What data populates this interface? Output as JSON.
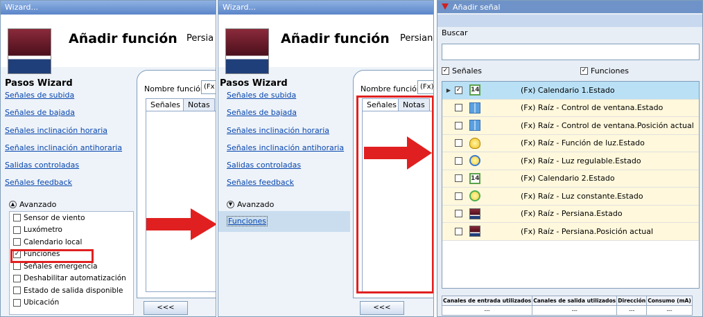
{
  "wizard_title": "Wizard...",
  "header": {
    "title": "Añadir función",
    "subtitle_p1": "Persia",
    "subtitle_p2": "Persian"
  },
  "steps_title": "Pasos Wizard",
  "steps": [
    "Señales de subida",
    "Señales de bajada",
    "Señales inclinación horaria",
    "Señales inclinación antihoraria",
    "Salidas controladas",
    "Señales feedback"
  ],
  "advanced_label": "Avanzado",
  "advanced_options": [
    {
      "label": "Sensor de viento",
      "checked": false
    },
    {
      "label": "Luxómetro",
      "checked": false
    },
    {
      "label": "Calendario local",
      "checked": false
    },
    {
      "label": "Funciones",
      "checked": true
    },
    {
      "label": "Señales emergencia",
      "checked": false
    },
    {
      "label": "Deshabilitar automatización",
      "checked": false
    },
    {
      "label": "Estado de salida disponible",
      "checked": false
    },
    {
      "label": "Ubicación",
      "checked": false
    }
  ],
  "funciones_link": "Funciones",
  "function_name_label": "Nombre función:",
  "function_name_value_p1": "(Fx",
  "function_name_value_p2": "(Fx)",
  "tabs": [
    "Señales",
    "Notas"
  ],
  "back_button": "<<<",
  "signal_dialog": {
    "title": "Añadir señal",
    "search_label": "Buscar",
    "search_value": "",
    "filter_signals": "Señales",
    "filter_functions": "Funciones",
    "items": [
      {
        "label": "(Fx) Calendario 1.Estado",
        "icon": "calendar-icon",
        "icon_text": "14",
        "checked": true,
        "selected": true
      },
      {
        "label": "(Fx) Raíz - Control de ventana.Estado",
        "icon": "window-icon",
        "checked": false
      },
      {
        "label": "(Fx) Raíz - Control de ventana.Posición actual",
        "icon": "window-icon",
        "checked": false
      },
      {
        "label": "(Fx) Raíz - Función de luz.Estado",
        "icon": "bulb-icon",
        "checked": false
      },
      {
        "label": "(Fx) Raíz - Luz regulable.Estado",
        "icon": "dimmable-light-icon",
        "checked": false
      },
      {
        "label": "(Fx) Calendario 2.Estado",
        "icon": "calendar-icon",
        "icon_text": "14",
        "checked": false
      },
      {
        "label": "(Fx) Raíz - Luz constante.Estado",
        "icon": "constant-light-icon",
        "checked": false
      },
      {
        "label": "(Fx) Raíz - Persiana.Estado",
        "icon": "blind-icon",
        "checked": false
      },
      {
        "label": "(Fx) Raíz - Persiana.Posición actual",
        "icon": "blind-icon",
        "checked": false
      }
    ],
    "table_headers": [
      "Canales de entrada utilizados",
      "Canales de salida utilizados",
      "Dirección",
      "Consumo (mA)"
    ],
    "table_values": [
      "---",
      "---",
      "---",
      "---"
    ]
  },
  "colors": {
    "highlight": "#e02020",
    "link": "#0645ad",
    "selected_row": "#b9e0f5"
  }
}
